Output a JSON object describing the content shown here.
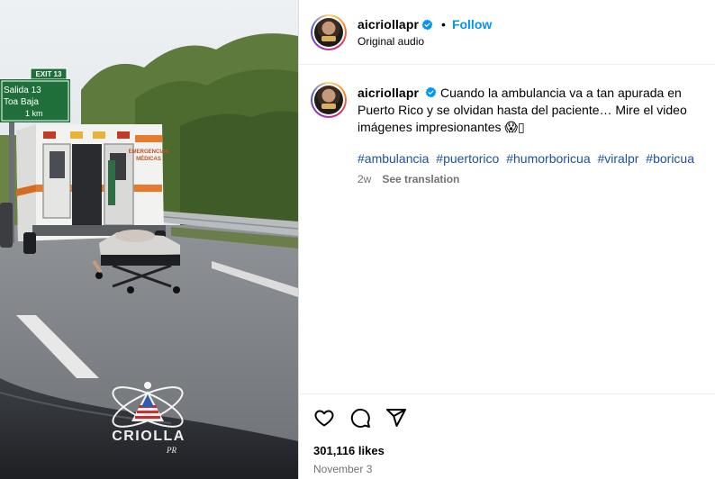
{
  "post": {
    "username": "aicriollapr",
    "follow_label": "Follow",
    "separator": "•",
    "audio_label": "Original audio",
    "caption": "Cuando la ambulancia va a tan apurada en Puerto Rico y se olvidan hasta del paciente… Mire el video imágenes impresionantes 😱▯",
    "hashtags": [
      "#ambulancia",
      "#puertorico",
      "#humorboricua",
      "#viralpr",
      "#boricua"
    ],
    "time_ago": "2w",
    "see_translation": "See translation",
    "likes": "301,116 likes",
    "date": "November 3"
  },
  "video": {
    "sign_exit_number": "EXIT 13",
    "sign_line1": "Salida 13",
    "sign_line2": "Toa Baja",
    "sign_line3": "1 km",
    "ambulance_text1": "EMERGENCIAS",
    "ambulance_text2": "MÉDICAS",
    "watermark_brand": "CRIOLLA",
    "watermark_sub": "PR"
  },
  "colors": {
    "follow": "#0095f6",
    "verified": "#0095f6",
    "hashtag": "#1e50a2",
    "muted": "#737373"
  },
  "icons": [
    "verified-badge-icon",
    "heart-icon",
    "comment-icon",
    "share-icon"
  ]
}
